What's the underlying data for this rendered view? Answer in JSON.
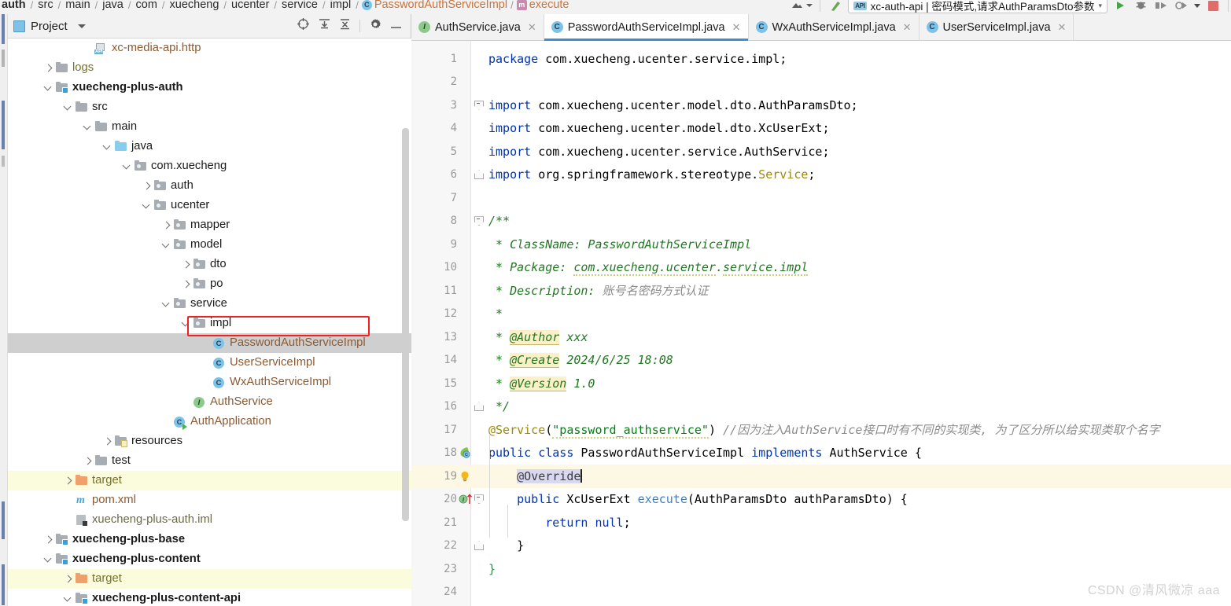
{
  "breadcrumb": {
    "segments": [
      "auth",
      "src",
      "main",
      "java",
      "com",
      "xuecheng",
      "ucenter",
      "service",
      "impl"
    ],
    "class": "PasswordAuthServiceImpl",
    "method": "execute"
  },
  "toolbar": {
    "run_config": "xc-auth-api | 密码模式,请求AuthParamsDto参数",
    "api_badge": "API",
    "run_label": "Run",
    "debug_label": "Debug",
    "coverage_label": "Run with Coverage",
    "profile_label": "Profile",
    "stop_label": "Stop",
    "more_label": "More",
    "upload_label": "Upload"
  },
  "project_panel": {
    "title": "Project",
    "tools": [
      "select-opened-file",
      "expand-all",
      "collapse-all",
      "settings",
      "hide"
    ]
  },
  "tree": [
    {
      "label": "xc-media-api.http",
      "icon": "http-file",
      "depth": 3,
      "arrow": "none",
      "style": "brown"
    },
    {
      "label": "logs",
      "icon": "folder-gray",
      "depth": 1,
      "arrow": "right",
      "style": "olive"
    },
    {
      "label": "xuecheng-plus-auth",
      "icon": "folder-module",
      "depth": 1,
      "arrow": "down",
      "style": "bold"
    },
    {
      "label": "src",
      "icon": "folder-gray",
      "depth": 2,
      "arrow": "down",
      "style": "plain"
    },
    {
      "label": "main",
      "icon": "folder-gray",
      "depth": 3,
      "arrow": "down",
      "style": "plain"
    },
    {
      "label": "java",
      "icon": "folder-source",
      "depth": 4,
      "arrow": "down",
      "style": "plain"
    },
    {
      "label": "com.xuecheng",
      "icon": "folder-package",
      "depth": 5,
      "arrow": "down",
      "style": "plain"
    },
    {
      "label": "auth",
      "icon": "folder-package",
      "depth": 6,
      "arrow": "right",
      "style": "plain"
    },
    {
      "label": "ucenter",
      "icon": "folder-package",
      "depth": 6,
      "arrow": "down",
      "style": "plain"
    },
    {
      "label": "mapper",
      "icon": "folder-package",
      "depth": 7,
      "arrow": "right",
      "style": "plain"
    },
    {
      "label": "model",
      "icon": "folder-package",
      "depth": 7,
      "arrow": "down",
      "style": "plain"
    },
    {
      "label": "dto",
      "icon": "folder-package",
      "depth": 8,
      "arrow": "right",
      "style": "plain"
    },
    {
      "label": "po",
      "icon": "folder-package",
      "depth": 8,
      "arrow": "right",
      "style": "plain"
    },
    {
      "label": "service",
      "icon": "folder-package",
      "depth": 7,
      "arrow": "down",
      "style": "plain"
    },
    {
      "label": "impl",
      "icon": "folder-package",
      "depth": 8,
      "arrow": "down",
      "style": "plain"
    },
    {
      "label": "PasswordAuthServiceImpl",
      "icon": "java-class",
      "depth": 9,
      "arrow": "none",
      "style": "brown",
      "selected": true,
      "highlighted": true
    },
    {
      "label": "UserServiceImpl",
      "icon": "java-class",
      "depth": 9,
      "arrow": "none",
      "style": "brown"
    },
    {
      "label": "WxAuthServiceImpl",
      "icon": "java-class",
      "depth": 9,
      "arrow": "none",
      "style": "brown"
    },
    {
      "label": "AuthService",
      "icon": "java-interface",
      "depth": 8,
      "arrow": "none",
      "style": "brown"
    },
    {
      "label": "AuthApplication",
      "icon": "java-application",
      "depth": 7,
      "arrow": "none",
      "style": "brown"
    },
    {
      "label": "resources",
      "icon": "folder-resources",
      "depth": 4,
      "arrow": "right",
      "style": "plain"
    },
    {
      "label": "test",
      "icon": "folder-gray",
      "depth": 3,
      "arrow": "right",
      "style": "plain"
    },
    {
      "label": "target",
      "icon": "folder-orange",
      "depth": 2,
      "arrow": "right",
      "style": "olive",
      "warn": true
    },
    {
      "label": "pom.xml",
      "icon": "maven-file",
      "depth": 2,
      "arrow": "none",
      "style": "brown"
    },
    {
      "label": "xuecheng-plus-auth.iml",
      "icon": "iml-file",
      "depth": 2,
      "arrow": "none",
      "style": "gray"
    },
    {
      "label": "xuecheng-plus-base",
      "icon": "folder-module",
      "depth": 1,
      "arrow": "right",
      "style": "bold"
    },
    {
      "label": "xuecheng-plus-content",
      "icon": "folder-module",
      "depth": 1,
      "arrow": "down",
      "style": "bold"
    },
    {
      "label": "target",
      "icon": "folder-orange",
      "depth": 2,
      "arrow": "right",
      "style": "olive",
      "warn": true
    },
    {
      "label": "xuecheng-plus-content-api",
      "icon": "folder-module",
      "depth": 2,
      "arrow": "down",
      "style": "bold"
    }
  ],
  "tabs": [
    {
      "label": "AuthService.java",
      "icon": "java-interface",
      "icon_letter": "I",
      "active": false
    },
    {
      "label": "PasswordAuthServiceImpl.java",
      "icon": "java-class",
      "icon_letter": "C",
      "active": true
    },
    {
      "label": "WxAuthServiceImpl.java",
      "icon": "java-class",
      "icon_letter": "C",
      "active": false
    },
    {
      "label": "UserServiceImpl.java",
      "icon": "java-class",
      "icon_letter": "C",
      "active": false
    }
  ],
  "code": {
    "file": "PasswordAuthServiceImpl.java",
    "language": "java",
    "caret_line": 19,
    "lines": [
      {
        "n": 1,
        "text": "package com.xuecheng.ucenter.service.impl;"
      },
      {
        "n": 2,
        "text": ""
      },
      {
        "n": 3,
        "text": "import com.xuecheng.ucenter.model.dto.AuthParamsDto;"
      },
      {
        "n": 4,
        "text": "import com.xuecheng.ucenter.model.dto.XcUserExt;"
      },
      {
        "n": 5,
        "text": "import com.xuecheng.ucenter.service.AuthService;"
      },
      {
        "n": 6,
        "text": "import org.springframework.stereotype.Service;"
      },
      {
        "n": 7,
        "text": ""
      },
      {
        "n": 8,
        "text": "/**"
      },
      {
        "n": 9,
        "text": " * ClassName: PasswordAuthServiceImpl"
      },
      {
        "n": 10,
        "text": " * Package: com.xuecheng.ucenter.service.impl"
      },
      {
        "n": 11,
        "text": " * Description: 账号名密码方式认证"
      },
      {
        "n": 12,
        "text": " *"
      },
      {
        "n": 13,
        "text": " * @Author xxx"
      },
      {
        "n": 14,
        "text": " * @Create 2024/6/25 18:08"
      },
      {
        "n": 15,
        "text": " * @Version 1.0"
      },
      {
        "n": 16,
        "text": " */"
      },
      {
        "n": 17,
        "text": "@Service(\"password_authservice\") //因为注入AuthService接口时有不同的实现类, 为了区分所以给实现类取个名字"
      },
      {
        "n": 18,
        "text": "public class PasswordAuthServiceImpl implements AuthService {",
        "gutter_icon": "spring-bean"
      },
      {
        "n": 19,
        "text": "    @Override",
        "gutter_icon": "intention-bulb",
        "caret": true
      },
      {
        "n": 20,
        "text": "    public XcUserExt execute(AuthParamsDto authParamsDto) {",
        "gutter_icon": "implementing-method"
      },
      {
        "n": 21,
        "text": "        return null;"
      },
      {
        "n": 22,
        "text": "    }"
      },
      {
        "n": 23,
        "text": "}"
      },
      {
        "n": 24,
        "text": ""
      }
    ]
  },
  "watermark": "CSDN @清风微凉 aaa",
  "colors": {
    "keyword": "#0033b3",
    "string": "#067d17",
    "comment": "#8c8c8c",
    "javadoc": "#227722",
    "annotation": "#9e880d",
    "method": "#3d80c4",
    "selection": "#cfcfcf",
    "caret_line": "#fdf8e3",
    "warn_row": "#fbfbdd",
    "accent": "#3f8fd0",
    "annotation_box": "#ee2222"
  }
}
